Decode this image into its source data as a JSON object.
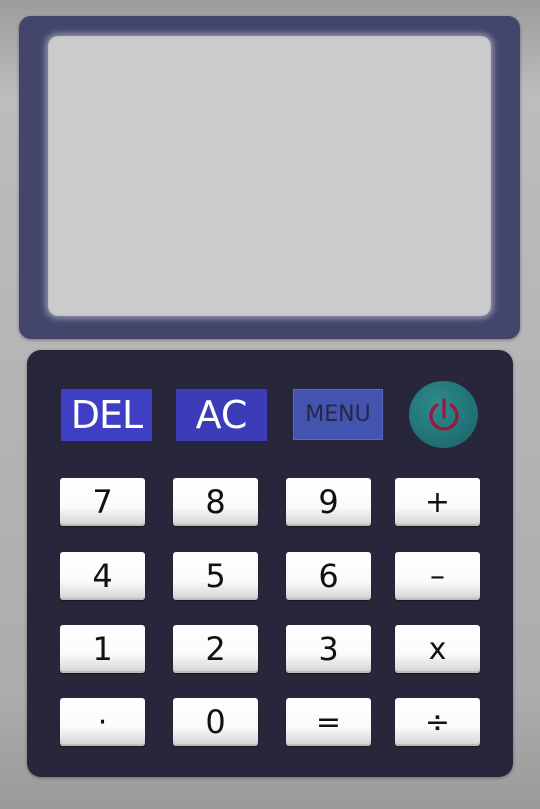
{
  "display": {
    "value": ""
  },
  "function_keys": {
    "del": "DEL",
    "ac": "AC",
    "menu": "MENU",
    "power_icon": "power-icon"
  },
  "keys": {
    "k7": "7",
    "k8": "8",
    "k9": "9",
    "plus": "+",
    "k4": "4",
    "k5": "5",
    "k6": "6",
    "minus": "–",
    "k1": "1",
    "k2": "2",
    "k3": "3",
    "times": "x",
    "dot": "·",
    "k0": "0",
    "equals": "=",
    "divide": "÷"
  },
  "colors": {
    "bezel": "#43456a",
    "display": "#cbcbcb",
    "keypad": "#27263a",
    "del_key": "#3f3fc6",
    "ac_key": "#3c3cb8",
    "menu_key": "#4254ae",
    "power_key": "#1f6f72",
    "power_symbol": "#a0143c"
  }
}
